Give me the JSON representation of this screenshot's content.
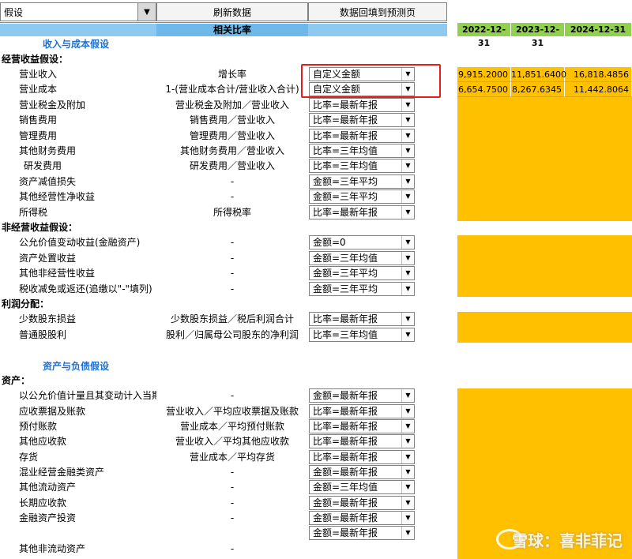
{
  "toolbar": {
    "assumption_select": "假设",
    "refresh_button": "刷新数据",
    "fill_back_button": "数据回填到预测页",
    "ratio_header": "相关比率"
  },
  "dates": [
    "2022-12-31",
    "2023-12-31",
    "2024-12-31"
  ],
  "sections": {
    "income_cost": "收入与成本假设",
    "operating": "经营收益假设：",
    "non_operating": "非经营收益假设：",
    "profit_dist": "利润分配：",
    "assets_liab": "资产与负债假设",
    "assets": "资产："
  },
  "rows": {
    "r1": {
      "label": "营业收入",
      "formula": "增长率",
      "option": "自定义金额",
      "v1": "9,915.2000",
      "v2": "11,851.6400",
      "v3": "16,818.4856"
    },
    "r2": {
      "label": "营业成本",
      "formula": "1-(营业成本合计/营业收入合计)",
      "option": "自定义金额",
      "v1": "6,654.7500",
      "v2": "8,267.6345",
      "v3": "11,442.8064"
    },
    "r3": {
      "label": "营业税金及附加",
      "formula": "营业税金及附加／营业收入",
      "option": "比率=最新年报"
    },
    "r4": {
      "label": "销售费用",
      "formula": "销售费用／营业收入",
      "option": "比率=最新年报"
    },
    "r5": {
      "label": "管理费用",
      "formula": "管理费用／营业收入",
      "option": "比率=最新年报"
    },
    "r6": {
      "label": "其他财务费用",
      "formula": "其他财务费用／营业收入",
      "option": "比率=三年均值"
    },
    "r7": {
      "label": "研发费用",
      "formula": "研发费用／营业收入",
      "option": "比率=三年均值"
    },
    "r8": {
      "label": "资产减值损失",
      "formula": "-",
      "option": "金额=三年平均"
    },
    "r9": {
      "label": "其他经营性净收益",
      "formula": "-",
      "option": "金额=三年平均"
    },
    "r10": {
      "label": "所得税",
      "formula": "所得税率",
      "option": "比率=最新年报"
    },
    "r11": {
      "label": "公允价值变动收益(金融资产)",
      "formula": "-",
      "option": "金额=0"
    },
    "r12": {
      "label": "资产处置收益",
      "formula": "-",
      "option": "金额=三年均值"
    },
    "r13": {
      "label": "其他非经营性收益",
      "formula": "-",
      "option": "金额=三年平均"
    },
    "r14": {
      "label": "税收减免或返还(追缴以\"-\"填列)",
      "formula": "-",
      "option": "金额=三年平均"
    },
    "r15": {
      "label": "少数股东损益",
      "formula": "少数股东损益／税后利润合计",
      "option": "比率=最新年报"
    },
    "r16": {
      "label": "普通股股利",
      "formula": "股利／归属母公司股东的净利润",
      "option": "比率=三年均值"
    },
    "r17": {
      "label": "以公允价值计量且其变动计入当期",
      "formula": "-",
      "option": "金额=最新年报"
    },
    "r18": {
      "label": "应收票据及账款",
      "formula": "营业收入／平均应收票据及账款",
      "option": "比率=最新年报"
    },
    "r19": {
      "label": "预付账款",
      "formula": "营业成本／平均预付账款",
      "option": "比率=最新年报"
    },
    "r20": {
      "label": "其他应收款",
      "formula": "营业收入／平均其他应收款",
      "option": "比率=最新年报"
    },
    "r21": {
      "label": "存货",
      "formula": "营业成本／平均存货",
      "option": "比率=最新年报"
    },
    "r22": {
      "label": "混业经营金融类资产",
      "formula": "-",
      "option": "金额=最新年报"
    },
    "r23": {
      "label": "其他流动资产",
      "formula": "-",
      "option": "金额=三年均值"
    },
    "r24": {
      "label": "长期应收款",
      "formula": "-",
      "option": "金额=最新年报"
    },
    "r25": {
      "label": "金融资产投资",
      "formula": "-",
      "option": "金额=最新年报"
    },
    "r26": {
      "option": "金额=最新年报"
    },
    "r27": {
      "label": "其他非流动资产",
      "formula": "-"
    }
  },
  "watermark": "雪球：喜非菲记"
}
